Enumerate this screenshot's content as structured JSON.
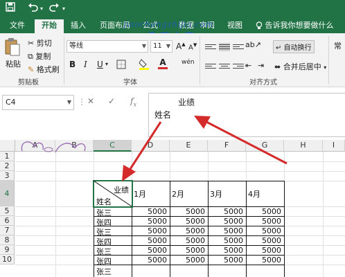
{
  "quick_access": {
    "save_icon": "save-icon",
    "undo_icon": "undo-icon",
    "redo_icon": "redo-icon"
  },
  "tabs": [
    {
      "label": "文件"
    },
    {
      "label": "开始"
    },
    {
      "label": "插入"
    },
    {
      "label": "页面布局"
    },
    {
      "label": "公式"
    },
    {
      "label": "数据"
    },
    {
      "label": "审阅"
    },
    {
      "label": "视图"
    }
  ],
  "tell_me": "告诉我你想要做什么",
  "watermark": {
    "line1": "jiaochengzhijia.com",
    "line2": "教 程 之 家"
  },
  "clipboard": {
    "paste": "粘贴",
    "cut": "剪切",
    "copy": "复制",
    "format_painter": "格式刷",
    "group": "剪贴板"
  },
  "font": {
    "name": "等线",
    "size": "11",
    "grow": "A",
    "shrink": "A",
    "bold": "B",
    "italic": "I",
    "underline": "U",
    "font_color_letter": "A",
    "phonetic": "wén",
    "group": "字体"
  },
  "alignment": {
    "wrap": "自动换行",
    "merge": "合并后居中",
    "group": "对齐方式"
  },
  "right_edge": "常",
  "name_box": "C4",
  "formula": {
    "line1": "业绩",
    "line2": "姓名"
  },
  "columns": [
    "A",
    "B",
    "C",
    "D",
    "E",
    "F",
    "G",
    "H",
    "I"
  ],
  "rows": [
    "1",
    "2",
    "3",
    "4",
    "5",
    "6",
    "7",
    "8",
    "9",
    "10"
  ],
  "table": {
    "header_top": "业绩",
    "header_bottom": "姓名",
    "months": [
      "1月",
      "2月",
      "3月",
      "4月"
    ],
    "rows": [
      {
        "name": "张三",
        "values": [
          "5000",
          "5000",
          "5000",
          "5000"
        ]
      },
      {
        "name": "张四",
        "values": [
          "5000",
          "5000",
          "5000",
          "5000"
        ]
      },
      {
        "name": "张三",
        "values": [
          "5000",
          "5000",
          "5000",
          "5000"
        ]
      },
      {
        "name": "张四",
        "values": [
          "5000",
          "5000",
          "5000",
          "5000"
        ]
      },
      {
        "name": "张三",
        "values": [
          "5000",
          "5000",
          "5000",
          "5000"
        ]
      },
      {
        "name": "张四",
        "values": [
          "5000",
          "5000",
          "5000",
          "5000"
        ]
      }
    ],
    "partial_name": "张三"
  },
  "colors": {
    "excel_green": "#217346",
    "arrow_red": "#d42a2a"
  }
}
